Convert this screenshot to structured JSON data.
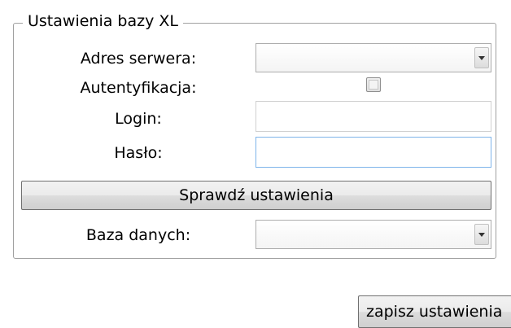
{
  "group": {
    "title": "Ustawienia bazy XL"
  },
  "fields": {
    "server_label": "Adres serwera:",
    "server_value": "",
    "auth_label": "Autentyfikacja:",
    "auth_checked": false,
    "login_label": "Login:",
    "login_value": "",
    "password_label": "Hasło:",
    "password_value": "",
    "database_label": "Baza danych:",
    "database_value": ""
  },
  "buttons": {
    "check_settings": "Sprawdź ustawienia",
    "save_settings": "zapisz ustawienia"
  }
}
